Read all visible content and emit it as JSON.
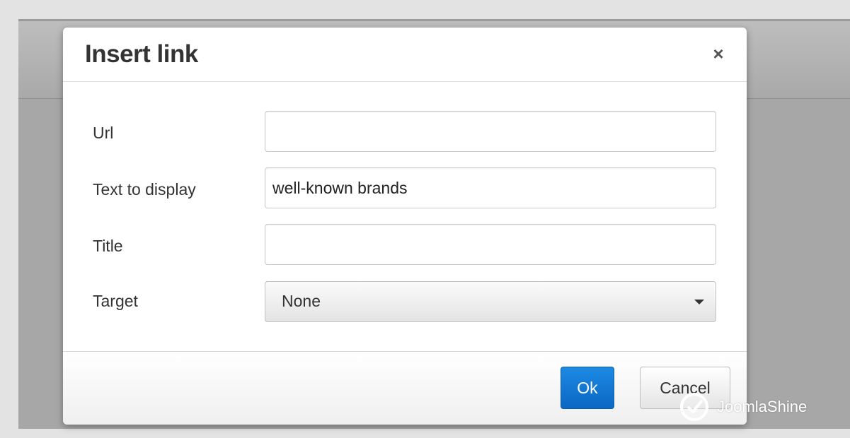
{
  "dialog": {
    "title": "Insert link",
    "close_symbol": "×"
  },
  "fields": {
    "url": {
      "label": "Url",
      "value": ""
    },
    "text_to_display": {
      "label": "Text to display",
      "value": "well-known brands"
    },
    "title": {
      "label": "Title",
      "value": ""
    },
    "target": {
      "label": "Target",
      "selected": "None"
    }
  },
  "buttons": {
    "ok": "Ok",
    "cancel": "Cancel"
  },
  "watermark": {
    "text": "JoomlaShine",
    "icon": "checkmark-circle-icon"
  },
  "colors": {
    "primary": "#0b67c2",
    "backdrop": "#a7a7a7"
  }
}
